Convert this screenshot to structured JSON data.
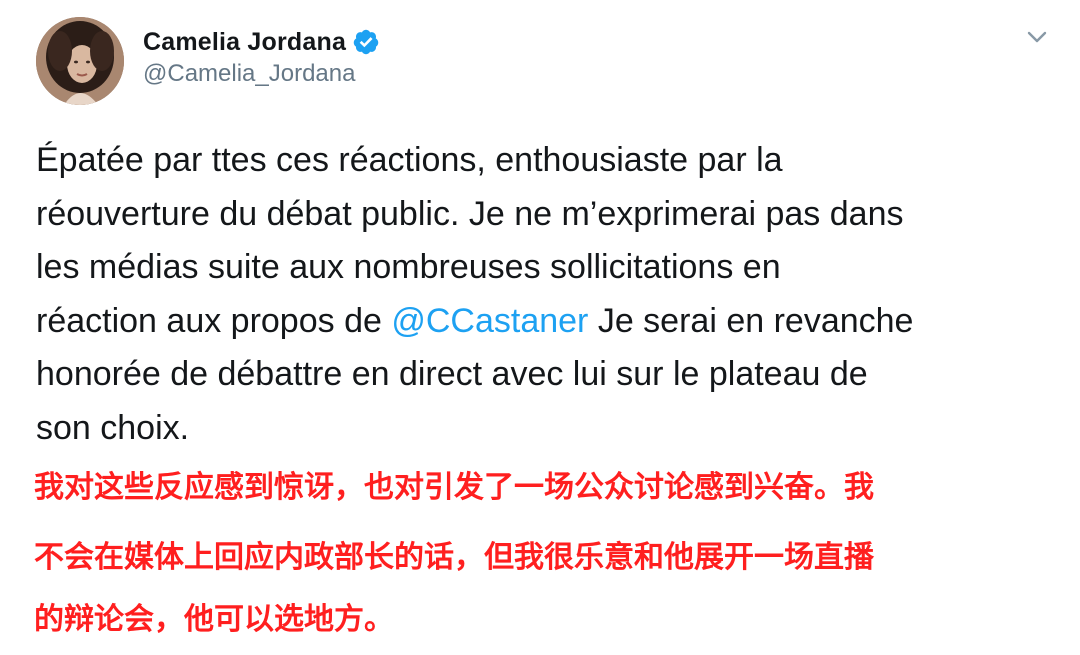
{
  "author": {
    "display_name": "Camelia Jordana",
    "handle": "@Camelia_Jordana",
    "verified": true,
    "avatar_icon": "user-avatar-photo"
  },
  "menu": {
    "icon": "chevron-down-icon"
  },
  "tweet": {
    "segment_1": "Épatée par ttes ces réactions, enthousiaste par la\nréouverture du débat public. Je ne m’exprimerai pas dans\nles médias suite aux nombreuses sollicitations en\nréaction aux propos de ",
    "mention": "@CCastaner",
    "segment_2": " Je serai en revanche\nhonorée de débattre en direct avec lui sur le plateau de\nson choix."
  },
  "translation": {
    "line_1": "我对这些反应感到惊讶，也对引发了一场公众讨论感到兴奋。我",
    "line_2": "不会在媒体上回应内政部长的话，但我很乐意和他展开一场直播",
    "line_3": "的辩论会，他可以选地方。"
  },
  "colors": {
    "text": "#14171a",
    "secondary": "#657786",
    "link": "#1da1f2",
    "verified": "#1da1f2",
    "translation": "#ff1f1f"
  }
}
